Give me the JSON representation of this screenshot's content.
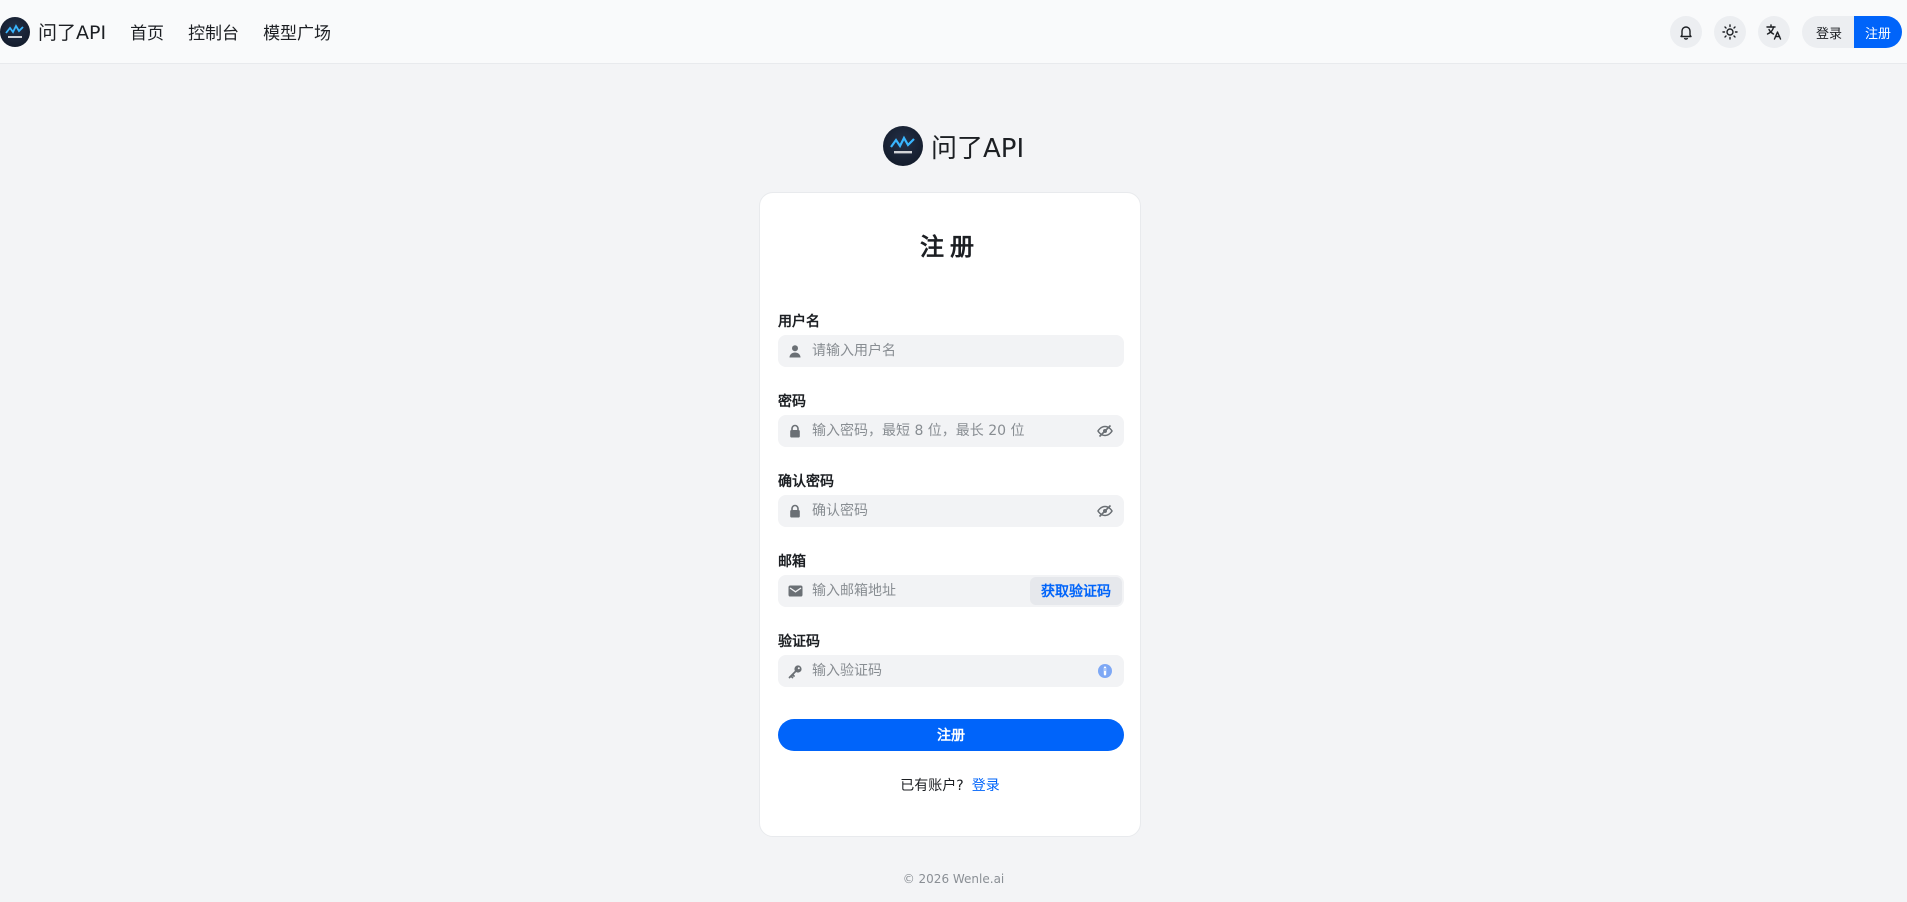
{
  "header": {
    "brand": "问了API",
    "nav": [
      "首页",
      "控制台",
      "模型广场"
    ],
    "login_label": "登录",
    "register_label": "注册",
    "icons": [
      "bell-icon",
      "sun-icon",
      "translate-icon"
    ]
  },
  "center": {
    "brand": "问了API"
  },
  "form": {
    "title": "注册",
    "username": {
      "label": "用户名",
      "placeholder": "请输入用户名"
    },
    "password": {
      "label": "密码",
      "placeholder": "输入密码，最短 8 位，最长 20 位"
    },
    "confirm": {
      "label": "确认密码",
      "placeholder": "确认密码"
    },
    "email": {
      "label": "邮箱",
      "placeholder": "输入邮箱地址",
      "code_button": "获取验证码"
    },
    "code": {
      "label": "验证码",
      "placeholder": "输入验证码"
    },
    "submit_label": "注册",
    "have_account": "已有账户?",
    "login_link": "登录"
  },
  "footer": {
    "copyright": "© 2026 Wenle.ai"
  },
  "colors": {
    "primary": "#0064fa",
    "background": "#f3f4f6"
  }
}
